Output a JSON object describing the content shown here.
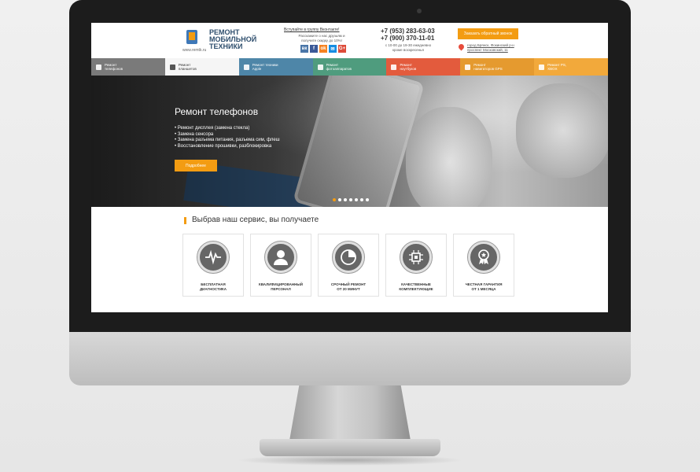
{
  "logo": {
    "title_line1": "РЕМОНТ",
    "title_line2": "МОБИЛЬНОЙ",
    "title_line3": "ТЕХНИКИ",
    "url": "www.remtk.ru"
  },
  "header": {
    "vk_join": "Вступайте в группу Вконтакте!",
    "vk_text": "Расскажите о нас друзьям и получите скидку до 10%!",
    "socials": [
      "вк",
      "f",
      "ok",
      "✉",
      "G+"
    ],
    "phone1": "+7 (953) 283-63-03",
    "phone2": "+7 (900) 370-11-01",
    "hours": "с 10-00 до 19-30 ежедневно кроме воскресенья",
    "callback_label": "Заказать обратный звонок",
    "address": "город Брянск, Фокинский р-н проспект Московский, 11"
  },
  "nav": [
    {
      "line1": "Ремонт",
      "line2": "телефонов",
      "color": "#7a7a7a"
    },
    {
      "line1": "Ремонт",
      "line2": "планшетов",
      "color": "#f5f5f5"
    },
    {
      "line1": "Ремонт техники",
      "line2": "Apple",
      "color": "#4e86a8"
    },
    {
      "line1": "Ремонт",
      "line2": "фотоаппаратов",
      "color": "#4f9c7e"
    },
    {
      "line1": "Ремонт",
      "line2": "ноутбуков",
      "color": "#e35b3d"
    },
    {
      "line1": "Ремонт",
      "line2": "навигаторов GPS",
      "color": "#e59a2f"
    },
    {
      "line1": "Ремонт PS,",
      "line2": "XBOX",
      "color": "#f2a93b"
    }
  ],
  "hero": {
    "title": "Ремонт телефонов",
    "items": [
      "Ремонт дисплея (замена стекла)",
      "Замена сенсора",
      "Замена разъема питания, разъема сим, флеш",
      "Восстановление прошивки, разблокировка"
    ],
    "button": "Подробнее",
    "slides": 7,
    "active_slide": 1
  },
  "features": {
    "title": "Выбрав наш сервис, вы получаете",
    "cards": [
      {
        "icon": "pulse-icon",
        "line1": "Бесплатная",
        "line2": "диагностика"
      },
      {
        "icon": "user-icon",
        "line1": "Квалифицированный",
        "line2": "персонал"
      },
      {
        "icon": "clock-icon",
        "line1": "Срочный ремонт",
        "line2": "от 20 минут"
      },
      {
        "icon": "chip-icon",
        "line1": "Качественные",
        "line2": "комплектующие"
      },
      {
        "icon": "award-icon",
        "line1": "Честная гарантия",
        "line2": "от 1 месяца"
      }
    ]
  },
  "colors": {
    "accent": "#f39c12",
    "brand": "#2e4e6d"
  }
}
